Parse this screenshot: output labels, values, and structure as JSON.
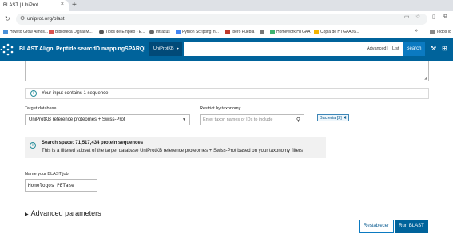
{
  "browser": {
    "tab_title": "BLAST | UniProt",
    "tab_close": "×",
    "new_tab": "+",
    "url": "uniprot.org/blast",
    "bookmarks": [
      {
        "label": "How to Grow Almos...",
        "color": "#4a90d9"
      },
      {
        "label": "Biblioteca Digital M...",
        "color": "#d9534f"
      },
      {
        "label": "Tipos de Empleo - E...",
        "color": "#555555"
      },
      {
        "label": "Intraxus",
        "color": "#666666"
      },
      {
        "label": "Python Scripting in...",
        "color": "#4285f4"
      },
      {
        "label": "Ibero Puebla",
        "color": "#c0392b"
      },
      {
        "label": "",
        "color": "#777777"
      },
      {
        "label": "Homework HTGAA",
        "color": "#3cb371"
      },
      {
        "label": "Copia de HTGAA26...",
        "color": "#f4b400"
      }
    ],
    "bookmarks_overflow": "»",
    "all_bookmarks": "Todos lo"
  },
  "uniprot_nav": {
    "items": [
      "BLAST",
      "Align",
      "Peptide search",
      "ID mapping",
      "SPARQL"
    ],
    "db_selector": "UniProtKB",
    "advanced": "Advanced",
    "separator": "|",
    "list": "List",
    "search": "Search"
  },
  "form": {
    "input_info": "Your input contains 1 sequence.",
    "target_db_label": "Target database",
    "target_db_value": "UniProtKB reference proteomes + Swiss-Prot",
    "taxonomy_label": "Restrict by taxonomy",
    "taxonomy_placeholder": "Enter taxon names or IDs to include",
    "taxonomy_chip": "Bacteria [2] ✖",
    "search_space_title": "Search space: 71,517,434 protein sequences",
    "search_space_desc": "This is a filtered subset of the target database UniProtKB reference proteomes + Swiss-Prot based on your taxonomy filters",
    "job_name_label": "Name your BLAST job",
    "job_name_value": "Homologos_PETase",
    "advanced_parameters": "Advanced parameters",
    "reset_button": "Restablecer",
    "run_button": "Run BLAST"
  }
}
